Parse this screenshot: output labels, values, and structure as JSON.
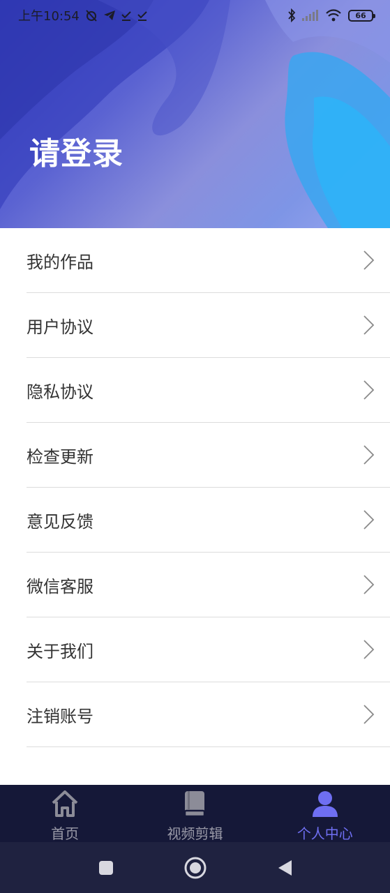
{
  "status_bar": {
    "time": "上午10:54",
    "battery": "66"
  },
  "header": {
    "login_text": "请登录"
  },
  "menu": {
    "items": [
      {
        "label": "我的作品"
      },
      {
        "label": "用户协议"
      },
      {
        "label": "隐私协议"
      },
      {
        "label": "检查更新"
      },
      {
        "label": "意见反馈"
      },
      {
        "label": "微信客服"
      },
      {
        "label": "关于我们"
      },
      {
        "label": "注销账号"
      }
    ]
  },
  "tabbar": {
    "tabs": [
      {
        "label": "首页",
        "icon": "home-icon",
        "active": false
      },
      {
        "label": "视频剪辑",
        "icon": "book-icon",
        "active": false
      },
      {
        "label": "个人中心",
        "icon": "person-icon",
        "active": true
      }
    ]
  },
  "colors": {
    "accent": "#6f6ff2",
    "tabbar_bg": "#151838",
    "header_start": "#3a44c9",
    "header_end": "#9aa6ef"
  }
}
